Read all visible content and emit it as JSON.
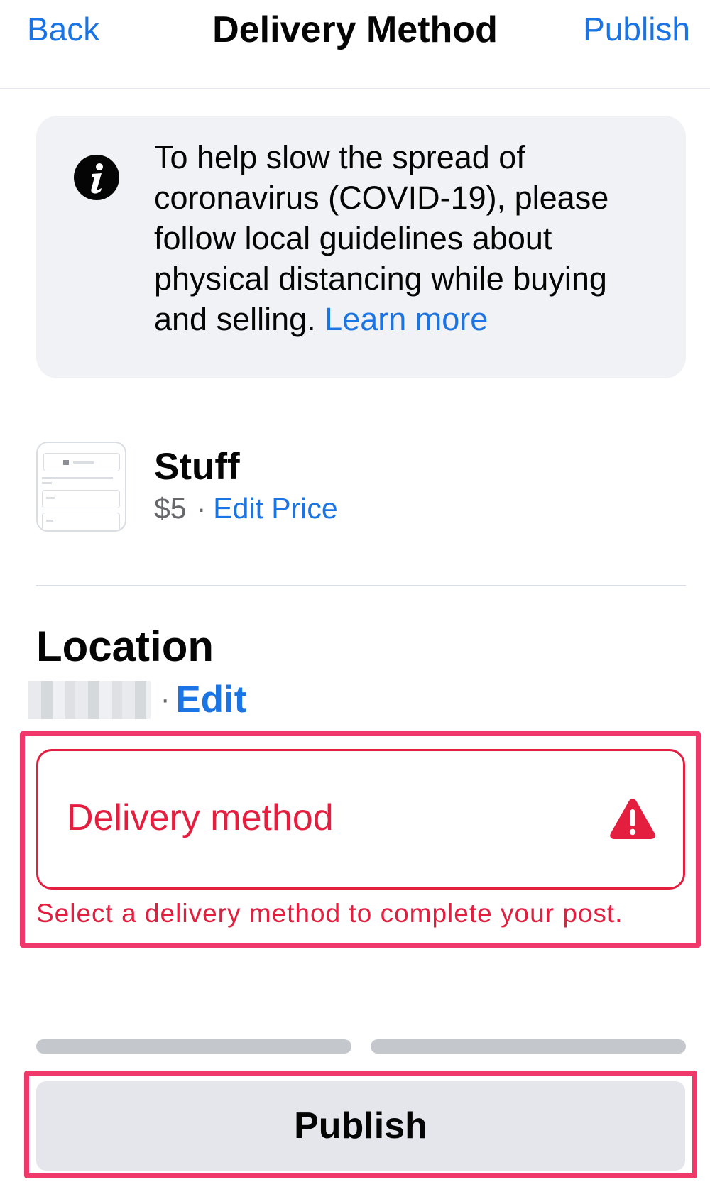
{
  "nav": {
    "back_label": "Back",
    "title": "Delivery Method",
    "publish_label": "Publish"
  },
  "notice": {
    "icon": "info-icon",
    "text": "To help slow the spread of coronavirus (COVID-19), please follow local guidelines about physical distancing while buying and selling. ",
    "link_label": "Learn more"
  },
  "item": {
    "title": "Stuff",
    "price": "$5",
    "separator": "·",
    "edit_price_label": "Edit Price"
  },
  "location": {
    "heading": "Location",
    "separator": "·",
    "edit_label": "Edit"
  },
  "delivery": {
    "label": "Delivery method",
    "warning_icon": "warning-icon",
    "error_text": "Select a delivery method to complete your post."
  },
  "footer": {
    "publish_label": "Publish"
  },
  "colors": {
    "link": "#1b74e4",
    "error": "#e41e3f",
    "highlight": "#f0386b",
    "notice_bg": "#f0f2f5",
    "button_bg": "#e4e6eb"
  }
}
